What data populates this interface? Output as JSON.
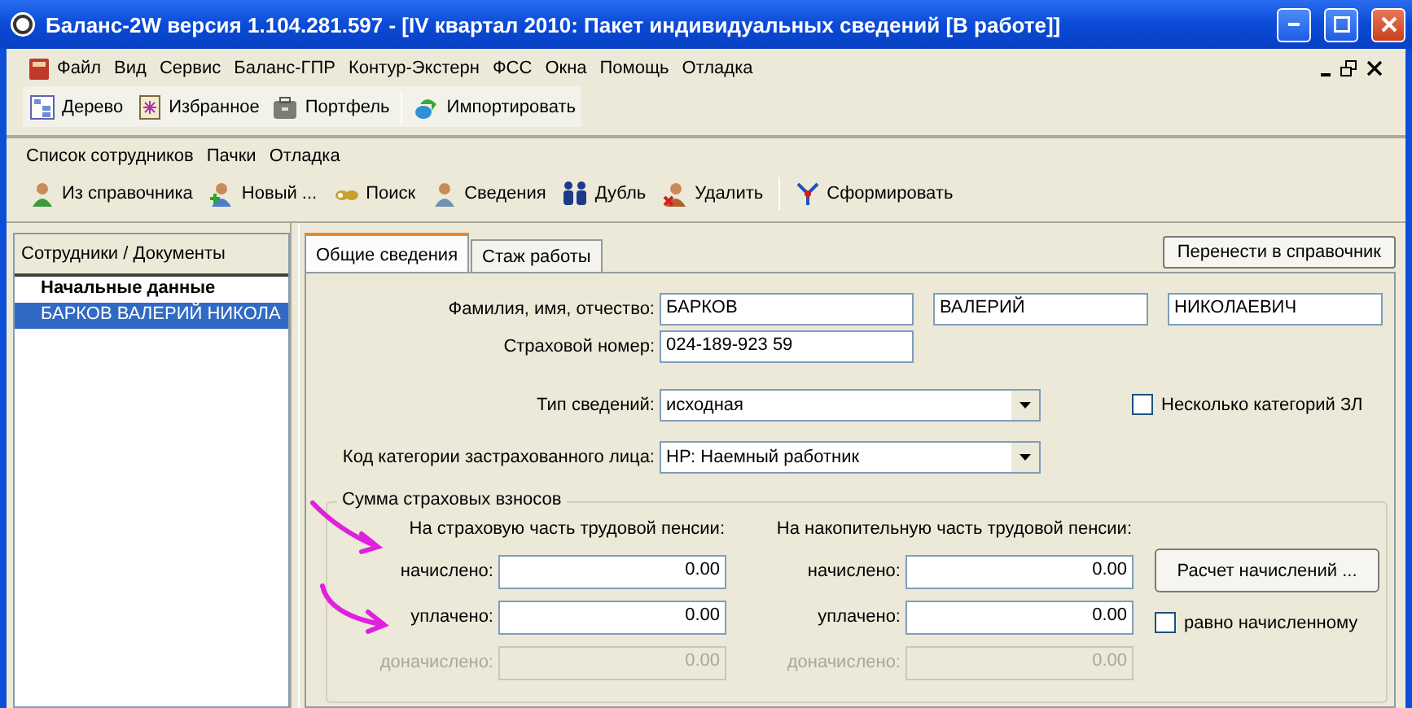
{
  "window": {
    "title": "Баланс-2W  версия 1.104.281.597 - [IV квартал 2010: Пакет индивидуальных сведений [В работе]]"
  },
  "menu": [
    "Файл",
    "Вид",
    "Сервис",
    "Баланс-ГПР",
    "Контур-Экстерн",
    "ФСС",
    "Окна",
    "Помощь",
    "Отладка"
  ],
  "toolbar": [
    "Дерево",
    "Избранное",
    "Портфель",
    "Импортировать"
  ],
  "inner_menu": [
    "Список сотрудников",
    "Пачки",
    "Отладка"
  ],
  "inner_toolbar": [
    "Из справочника",
    "Новый ...",
    "Поиск",
    "Сведения",
    "Дубль",
    "Удалить",
    "Сформировать"
  ],
  "sidebar": {
    "header": "Сотрудники / Документы",
    "items": [
      {
        "label": "Начальные данные",
        "kind": "header",
        "selected": false
      },
      {
        "label": "БАРКОВ ВАЛЕРИЙ НИКОЛА",
        "kind": "item",
        "selected": true
      }
    ]
  },
  "tabs": [
    {
      "label": "Общие сведения",
      "selected": true
    },
    {
      "label": "Стаж работы",
      "selected": false
    }
  ],
  "transfer_button": "Перенести в справочник",
  "form": {
    "fio_label": "Фамилия, имя, отчество:",
    "surname": "БАРКОВ",
    "name": "ВАЛЕРИЙ",
    "patronymic": "НИКОЛАЕВИЧ",
    "snils_label": "Страховой номер:",
    "snils": "024-189-923 59",
    "type_label": "Тип сведений:",
    "type": "исходная",
    "multi_label": "Несколько категорий ЗЛ",
    "multi_checked": false,
    "category_label": "Код категории застрахованного лица:",
    "category": "НР: Наемный работник"
  },
  "contributions": {
    "title": "Сумма страховых взносов",
    "columns": [
      {
        "title": "На страховую часть трудовой пенсии:",
        "rows": [
          {
            "label": "начислено:",
            "value": "0.00",
            "disabled": false
          },
          {
            "label": "уплачено:",
            "value": "0.00",
            "disabled": false
          },
          {
            "label": "доначислено:",
            "value": "0.00",
            "disabled": true
          }
        ]
      },
      {
        "title": "На накопительную часть трудовой пенсии:",
        "rows": [
          {
            "label": "начислено:",
            "value": "0.00",
            "disabled": false
          },
          {
            "label": "уплачено:",
            "value": "0.00",
            "disabled": false
          },
          {
            "label": "доначислено:",
            "value": "0.00",
            "disabled": true
          }
        ]
      }
    ],
    "calc_button": "Расчет начислений ...",
    "equal_label": "равно начисленному",
    "equal_checked": false
  }
}
